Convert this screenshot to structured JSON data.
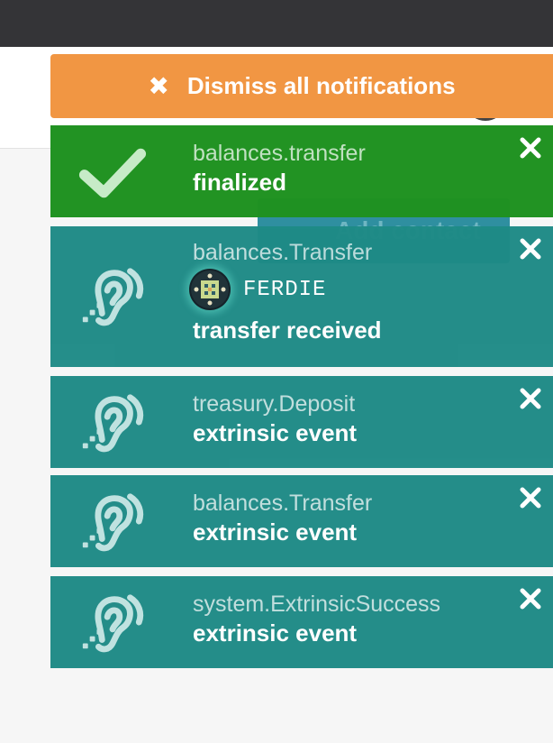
{
  "dismiss": {
    "label": "Dismiss all notifications"
  },
  "background": {
    "button_label": "Add contact"
  },
  "notifications": [
    {
      "title": "balances.transfer",
      "status": "finalized",
      "kind": "success",
      "icon": "checkmark-icon"
    },
    {
      "title": "balances.Transfer",
      "account": "FERDIE",
      "status": "transfer received",
      "kind": "event",
      "icon": "ear-icon"
    },
    {
      "title": "treasury.Deposit",
      "status": "extrinsic event",
      "kind": "event",
      "icon": "ear-icon"
    },
    {
      "title": "balances.Transfer",
      "status": "extrinsic event",
      "kind": "event",
      "icon": "ear-icon"
    },
    {
      "title": "system.ExtrinsicSuccess",
      "status": "extrinsic event",
      "kind": "event",
      "icon": "ear-icon"
    }
  ],
  "colors": {
    "dismiss": "#f19643",
    "success": "#1f9220",
    "event": "#1e8a86"
  }
}
